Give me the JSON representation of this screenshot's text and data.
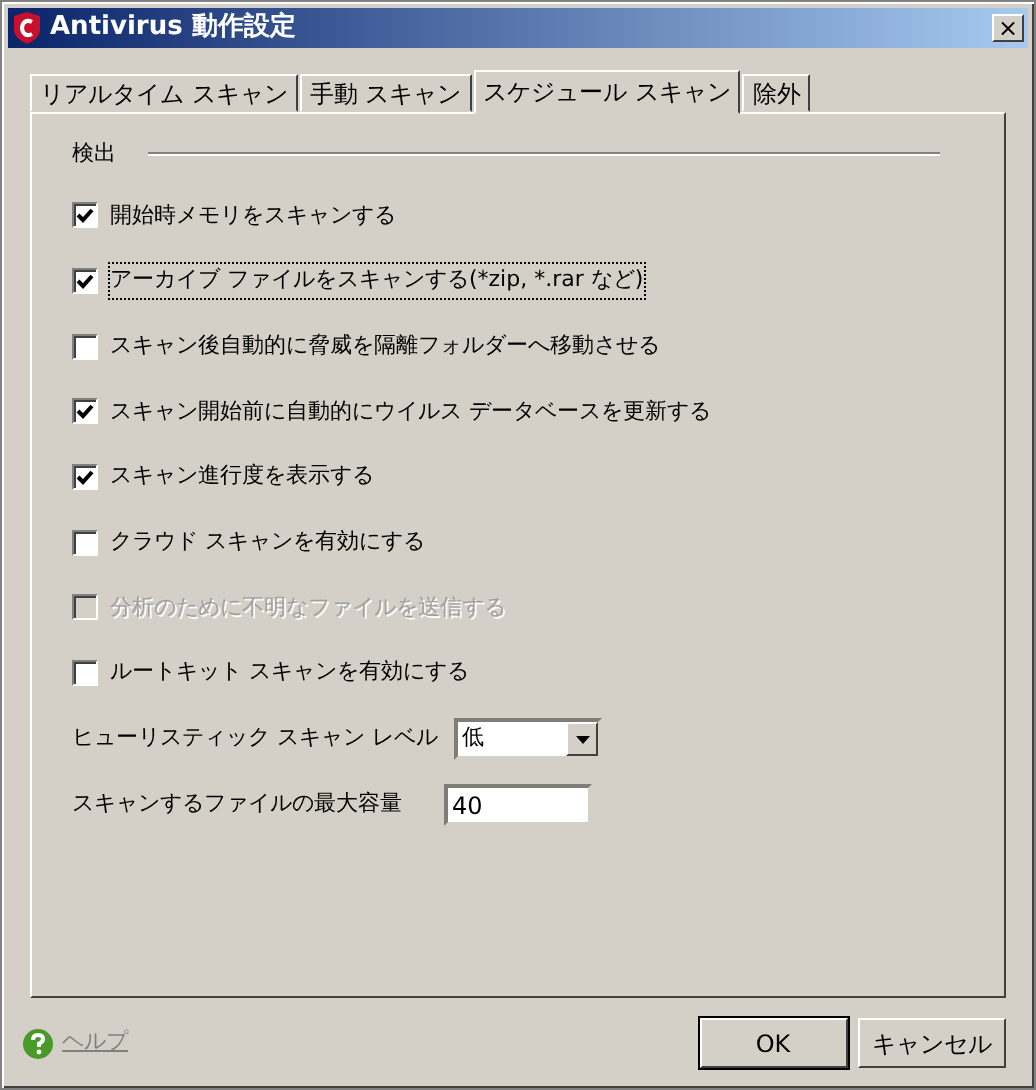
{
  "window": {
    "title": "Antivirus 動作設定",
    "close": "×"
  },
  "tabs": [
    {
      "label": "リアルタイム スキャン",
      "selected": false
    },
    {
      "label": "手動 スキャン",
      "selected": false
    },
    {
      "label": "スケジュール スキャン",
      "selected": true
    },
    {
      "label": "除外",
      "selected": false
    }
  ],
  "section": "検出",
  "options": [
    {
      "label": "開始時メモリをスキャンする",
      "checked": true,
      "disabled": false,
      "focused": false
    },
    {
      "label": "アーカイブ ファイルをスキャンする(*zip, *.rar など)",
      "checked": true,
      "disabled": false,
      "focused": true
    },
    {
      "label": "スキャン後自動的に脅威を隔離フォルダーへ移動させる",
      "checked": false,
      "disabled": false,
      "focused": false
    },
    {
      "label": "スキャン開始前に自動的にウイルス データベースを更新する",
      "checked": true,
      "disabled": false,
      "focused": false
    },
    {
      "label": "スキャン進行度を表示する",
      "checked": true,
      "disabled": false,
      "focused": false
    },
    {
      "label": "クラウド スキャンを有効にする",
      "checked": false,
      "disabled": false,
      "focused": false
    },
    {
      "label": "分析のために不明なファイルを送信する",
      "checked": false,
      "disabled": true,
      "focused": false
    },
    {
      "label": "ルートキット スキャンを有効にする",
      "checked": false,
      "disabled": false,
      "focused": false
    }
  ],
  "fields": [
    {
      "kind": "select",
      "label": "ヒューリスティック スキャン レベル",
      "value": "低"
    },
    {
      "kind": "text",
      "label": "スキャンするファイルの最大容量",
      "value": "40"
    }
  ],
  "help": "ヘルプ",
  "buttons": [
    {
      "label": "OK",
      "default": true
    },
    {
      "label": "キャンセル",
      "default": false
    }
  ]
}
